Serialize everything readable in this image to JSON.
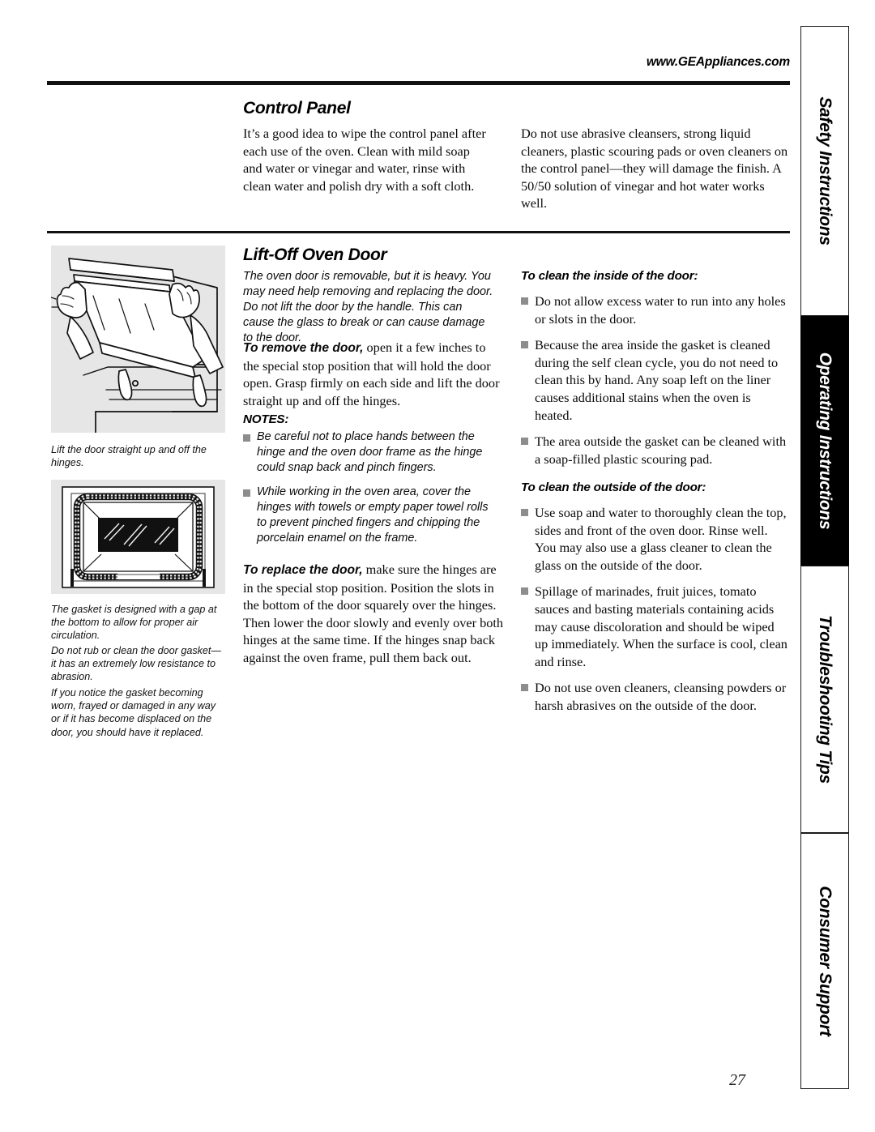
{
  "header": {
    "site_url": "www.GEAppliances.com"
  },
  "sections": {
    "control_panel": {
      "title": "Control Panel",
      "col_left": "It’s a good idea to wipe the control panel after each use of the oven. Clean with mild soap and water or vinegar and water, rinse with clean water and polish dry with a soft cloth.",
      "col_right": "Do not use abrasive cleansers, strong liquid cleaners, plastic scouring pads or oven cleaners on the control panel—they will damage the finish. A 50/50 solution of vinegar and hot water works well."
    },
    "lift_off_oven_door": {
      "title": "Lift-Off Oven Door",
      "intro": "The oven door is removable, but it is heavy. You may need help removing and replacing the door. Do not lift the door by the handle. This can cause the glass to break or can cause damage to the door.",
      "remove_lead": "To remove the door,",
      "remove_body": "open it a few inches to the special stop position that will hold the door open. Grasp firmly on each side and lift the door straight up and off the hinges.",
      "notes_heading": "NOTES:",
      "notes": [
        "Be careful not to place hands between the hinge and the oven door frame as the hinge could snap back and pinch fingers.",
        "While working in the oven area, cover the hinges with towels or empty paper towel rolls to prevent pinched fingers and chipping the porcelain enamel on the frame."
      ],
      "replace_lead": "To replace the door,",
      "replace_body": "make sure the hinges are in the special stop position. Position the slots in the bottom of the door squarely over the hinges. Then lower the door slowly and evenly over both hinges at the same time. If the hinges snap back against the oven frame, pull them back out."
    },
    "clean_inside": {
      "heading": "To clean the inside of the door:",
      "bullets": [
        "Do not allow excess water to run into any holes or slots in the door.",
        "Because the area inside the gasket is cleaned during the self clean cycle, you do not need to clean this by hand. Any soap left on the liner causes additional stains when the oven is heated.",
        "The area outside the gasket can be cleaned with a soap-filled plastic scouring pad."
      ]
    },
    "clean_outside": {
      "heading": "To clean the outside of the door:",
      "bullets": [
        "Use soap and water to thoroughly clean the top, sides and front of the oven door. Rinse well. You may also use a glass cleaner to clean the glass on the outside of the door.",
        "Spillage of marinades, fruit juices, tomato sauces and basting materials containing acids may cause discoloration and should be wiped up immediately. When the surface is cool, clean and rinse.",
        "Do not use oven cleaners, cleansing powders or harsh abrasives on the outside of the door."
      ]
    }
  },
  "figures": {
    "door_lift": {
      "name": "oven-door-lift-illustration",
      "caption": "Lift the door straight up and off the hinges."
    },
    "door_gasket": {
      "name": "oven-door-gasket-illustration",
      "captions": [
        "The gasket is designed with a gap at the bottom to allow for proper air circulation.",
        "Do not rub or clean the door gasket—it has an extremely low resistance to abrasion.",
        "If you notice the gasket becoming worn, frayed or damaged in any way or if it has become displaced on the door, you should have it replaced."
      ]
    }
  },
  "tabs": [
    {
      "label": "Safety Instructions",
      "active": false
    },
    {
      "label": "Operating Instructions",
      "active": true
    },
    {
      "label": "Troubleshooting Tips",
      "active": false
    },
    {
      "label": "Consumer Support",
      "active": false
    }
  ],
  "footer": {
    "page_number": "27"
  },
  "colors": {
    "ink": "#000000",
    "figure_bg": "#e6e6e6",
    "bullet": "#8d8d8d",
    "active_tab_bg": "#000000"
  }
}
